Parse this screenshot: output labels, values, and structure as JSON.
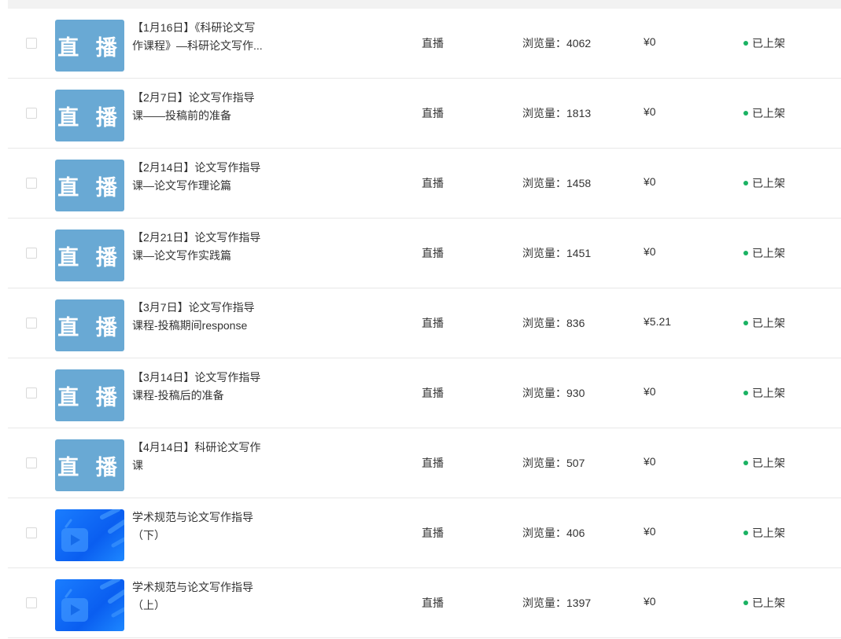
{
  "colors": {
    "status_dot": "#1ab263",
    "live_thumb": "#69a9d4",
    "blue_thumb": "#0a5ef0"
  },
  "items": [
    {
      "thumb": "live",
      "thumb_text": "直 播",
      "title_lines": [
        "【1月16日】《科研论文写",
        "作课程》—科研论文写作..."
      ],
      "type": "直播",
      "views": "浏览量：4062",
      "price": "¥0",
      "status": "已上架"
    },
    {
      "thumb": "live",
      "thumb_text": "直 播",
      "title_lines": [
        "【2月7日】论文写作指导",
        "课——投稿前的准备"
      ],
      "type": "直播",
      "views": "浏览量：1813",
      "price": "¥0",
      "status": "已上架"
    },
    {
      "thumb": "live",
      "thumb_text": "直 播",
      "title_lines": [
        "【2月14日】论文写作指导",
        "课—论文写作理论篇"
      ],
      "type": "直播",
      "views": "浏览量：1458",
      "price": "¥0",
      "status": "已上架"
    },
    {
      "thumb": "live",
      "thumb_text": "直 播",
      "title_lines": [
        "【2月21日】论文写作指导",
        "课—论文写作实践篇"
      ],
      "type": "直播",
      "views": "浏览量：1451",
      "price": "¥0",
      "status": "已上架"
    },
    {
      "thumb": "live",
      "thumb_text": "直 播",
      "title_lines": [
        "【3月7日】论文写作指导",
        "课程-投稿期间response"
      ],
      "type": "直播",
      "views": "浏览量：836",
      "price": "¥5.21",
      "status": "已上架"
    },
    {
      "thumb": "live",
      "thumb_text": "直 播",
      "title_lines": [
        "【3月14日】论文写作指导",
        "课程-投稿后的准备"
      ],
      "type": "直播",
      "views": "浏览量：930",
      "price": "¥0",
      "status": "已上架"
    },
    {
      "thumb": "live",
      "thumb_text": "直 播",
      "title_lines": [
        "【4月14日】科研论文写作",
        "课"
      ],
      "type": "直播",
      "views": "浏览量：507",
      "price": "¥0",
      "status": "已上架"
    },
    {
      "thumb": "blue",
      "thumb_text": "",
      "title_lines": [
        "学术规范与论文写作指导",
        "（下）"
      ],
      "type": "直播",
      "views": "浏览量：406",
      "price": "¥0",
      "status": "已上架"
    },
    {
      "thumb": "blue",
      "thumb_text": "",
      "title_lines": [
        "学术规范与论文写作指导",
        "（上）"
      ],
      "type": "直播",
      "views": "浏览量：1397",
      "price": "¥0",
      "status": "已上架"
    }
  ]
}
